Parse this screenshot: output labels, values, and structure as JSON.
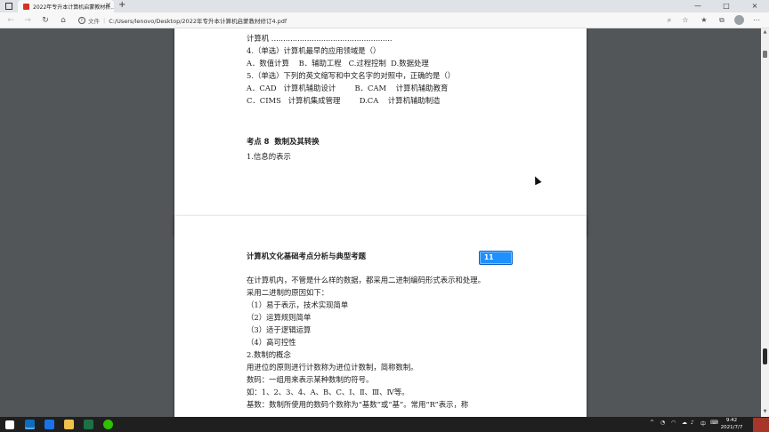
{
  "browser": {
    "tab_title": "2022年专升本计算机启蒙教材析...",
    "tab_close": "×",
    "new_tab": "+",
    "address_label": "文件",
    "url": "C:/Users/lenovo/Desktop/2022年专升本计算机启蒙教材修订4.pdf",
    "window_controls": [
      "—",
      "□",
      "×"
    ]
  },
  "page1": {
    "lines": [
      "计算机 ...................................................",
      "4.（单选）计算机最早的应用领域是（）",
      "A．数值计算    B．辅助工程   C.过程控制  D.数据处理",
      "5.（单选）下列的英文缩写和中文名字的对照中，正确的是（）",
      "A．CAD   计算机辅助设计        B．CAM    计算机辅助教育",
      "C．CIMS   计算机集成管理        D.CA    计算机辅助制造"
    ],
    "section_title": "考点 8  数制及其转换",
    "sub_line": "1.信息的表示"
  },
  "page2": {
    "header": "计算机文化基础考点分析与典型考题",
    "page_number": "11",
    "lines": [
      "在计算机内，不管是什么样的数据，都采用二进制编码形式表示和处理。",
      "采用二进制的原因如下：",
      "（1）易于表示，技术实现简单",
      "（2）运算规则简单",
      "（3）适于逻辑运算",
      "（4）高可控性",
      "2.数制的概念",
      "用进位的原则进行计数称为进位计数制，简称数制。",
      "数码：一组用来表示某种数制的符号。",
      "如：1、2、3、4、A、B、C、Ⅰ、Ⅱ、Ⅲ、Ⅳ等。",
      "基数：数制所使用的数码个数称为“基数”或“基”。常用“R”表示，称"
    ]
  },
  "taskbar": {
    "time": "9:42",
    "date": "2021/7/7",
    "ime": "中"
  },
  "colors": {
    "accent": "#1e90ff",
    "viewer_bg": "#525659",
    "taskbar_bg": "#1f1f1f"
  }
}
